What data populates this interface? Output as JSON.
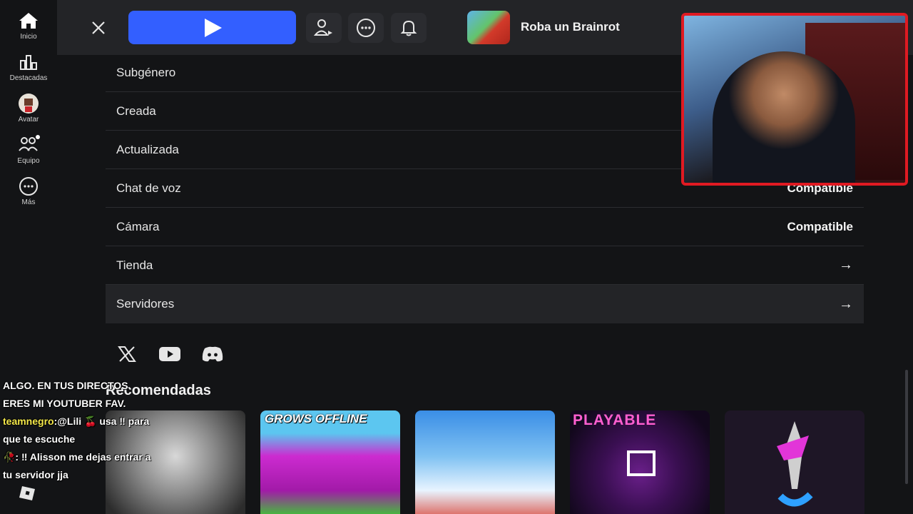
{
  "nav": {
    "items": [
      {
        "label": "Inicio",
        "icon": "home-icon"
      },
      {
        "label": "Destacadas",
        "icon": "charts-icon"
      },
      {
        "label": "Avatar",
        "icon": "avatar-icon"
      },
      {
        "label": "Equipo",
        "icon": "team-icon"
      },
      {
        "label": "Más",
        "icon": "more-icon"
      }
    ]
  },
  "topbar": {
    "close_icon": "close-icon",
    "play_icon": "play-icon",
    "buttons": [
      "add-friend-icon",
      "chat-icon",
      "notification-icon"
    ],
    "game_title": "Roba un Brainrot"
  },
  "details": {
    "rows": [
      {
        "label": "Subgénero",
        "value": "",
        "arrow": false
      },
      {
        "label": "Creada",
        "value": "",
        "arrow": false
      },
      {
        "label": "Actualizada",
        "value": "",
        "arrow": false
      },
      {
        "label": "Chat de voz",
        "value": "Compatible",
        "arrow": false
      },
      {
        "label": "Cámara",
        "value": "Compatible",
        "arrow": false
      },
      {
        "label": "Tienda",
        "value": "",
        "arrow": true
      },
      {
        "label": "Servidores",
        "value": "",
        "arrow": true
      }
    ],
    "arrow_glyph": "→"
  },
  "socials": [
    "x-icon",
    "youtube-icon",
    "discord-icon"
  ],
  "recommended": {
    "title": "Recomendadas",
    "cards": [
      {
        "title": ""
      },
      {
        "title": "GROWS OFFLINE"
      },
      {
        "title": ""
      },
      {
        "title": "PLAYABLE"
      },
      {
        "title": ""
      }
    ]
  },
  "chat_overlay": {
    "lines": [
      {
        "user": "",
        "text": "ALGO. EN TUS DIRECTOS"
      },
      {
        "user": "",
        "text": "ERES MI YOUTUBER FAV."
      },
      {
        "user": "teamnegro",
        "text": ":@Lili 🍒 usa ‼ para"
      },
      {
        "user": "",
        "text": "que te escuche"
      },
      {
        "user": "",
        "text": "🥀: ‼ Alisson me dejas entrar a"
      },
      {
        "user": "",
        "text": "tu servidor jja"
      }
    ]
  },
  "colors": {
    "background": "#131416",
    "topbar": "#232427",
    "play_button": "#335fff",
    "webcam_border": "#e01a22",
    "chat_username": "#f4e84a"
  }
}
